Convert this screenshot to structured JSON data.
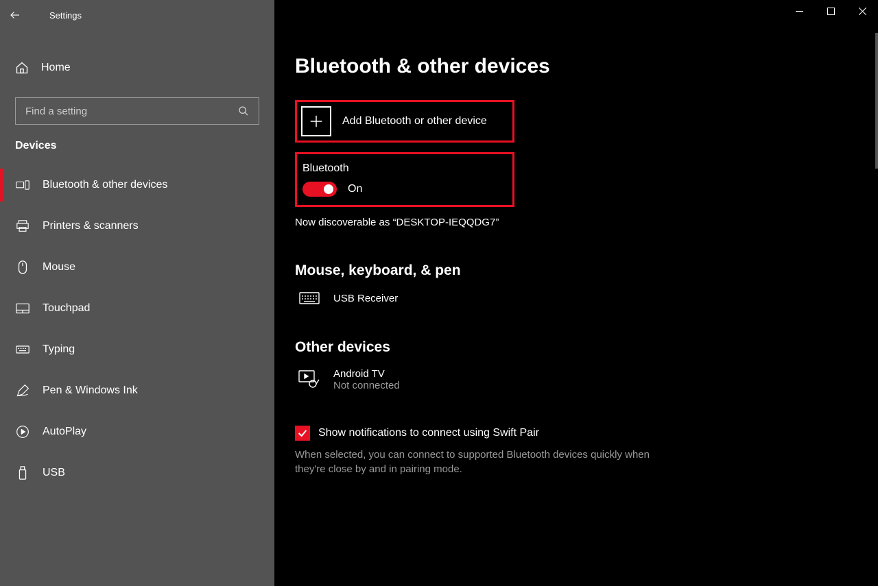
{
  "window": {
    "title": "Settings"
  },
  "sidebar": {
    "home_label": "Home",
    "search_placeholder": "Find a setting",
    "section": "Devices",
    "items": [
      {
        "label": "Bluetooth & other devices"
      },
      {
        "label": "Printers & scanners"
      },
      {
        "label": "Mouse"
      },
      {
        "label": "Touchpad"
      },
      {
        "label": "Typing"
      },
      {
        "label": "Pen & Windows Ink"
      },
      {
        "label": "AutoPlay"
      },
      {
        "label": "USB"
      }
    ]
  },
  "main": {
    "title": "Bluetooth & other devices",
    "add_device_label": "Add Bluetooth or other device",
    "bluetooth_label": "Bluetooth",
    "bluetooth_toggle_state": "On",
    "discoverable_text": "Now discoverable as “DESKTOP-IEQQDG7”",
    "section_mouse": "Mouse, keyboard, & pen",
    "device_mouse": {
      "name": "USB Receiver"
    },
    "section_other": "Other devices",
    "device_other": {
      "name": "Android TV",
      "status": "Not connected"
    },
    "swift_pair_label": "Show notifications to connect using Swift Pair",
    "swift_pair_desc": "When selected, you can connect to supported Bluetooth devices quickly when they're close by and in pairing mode."
  }
}
